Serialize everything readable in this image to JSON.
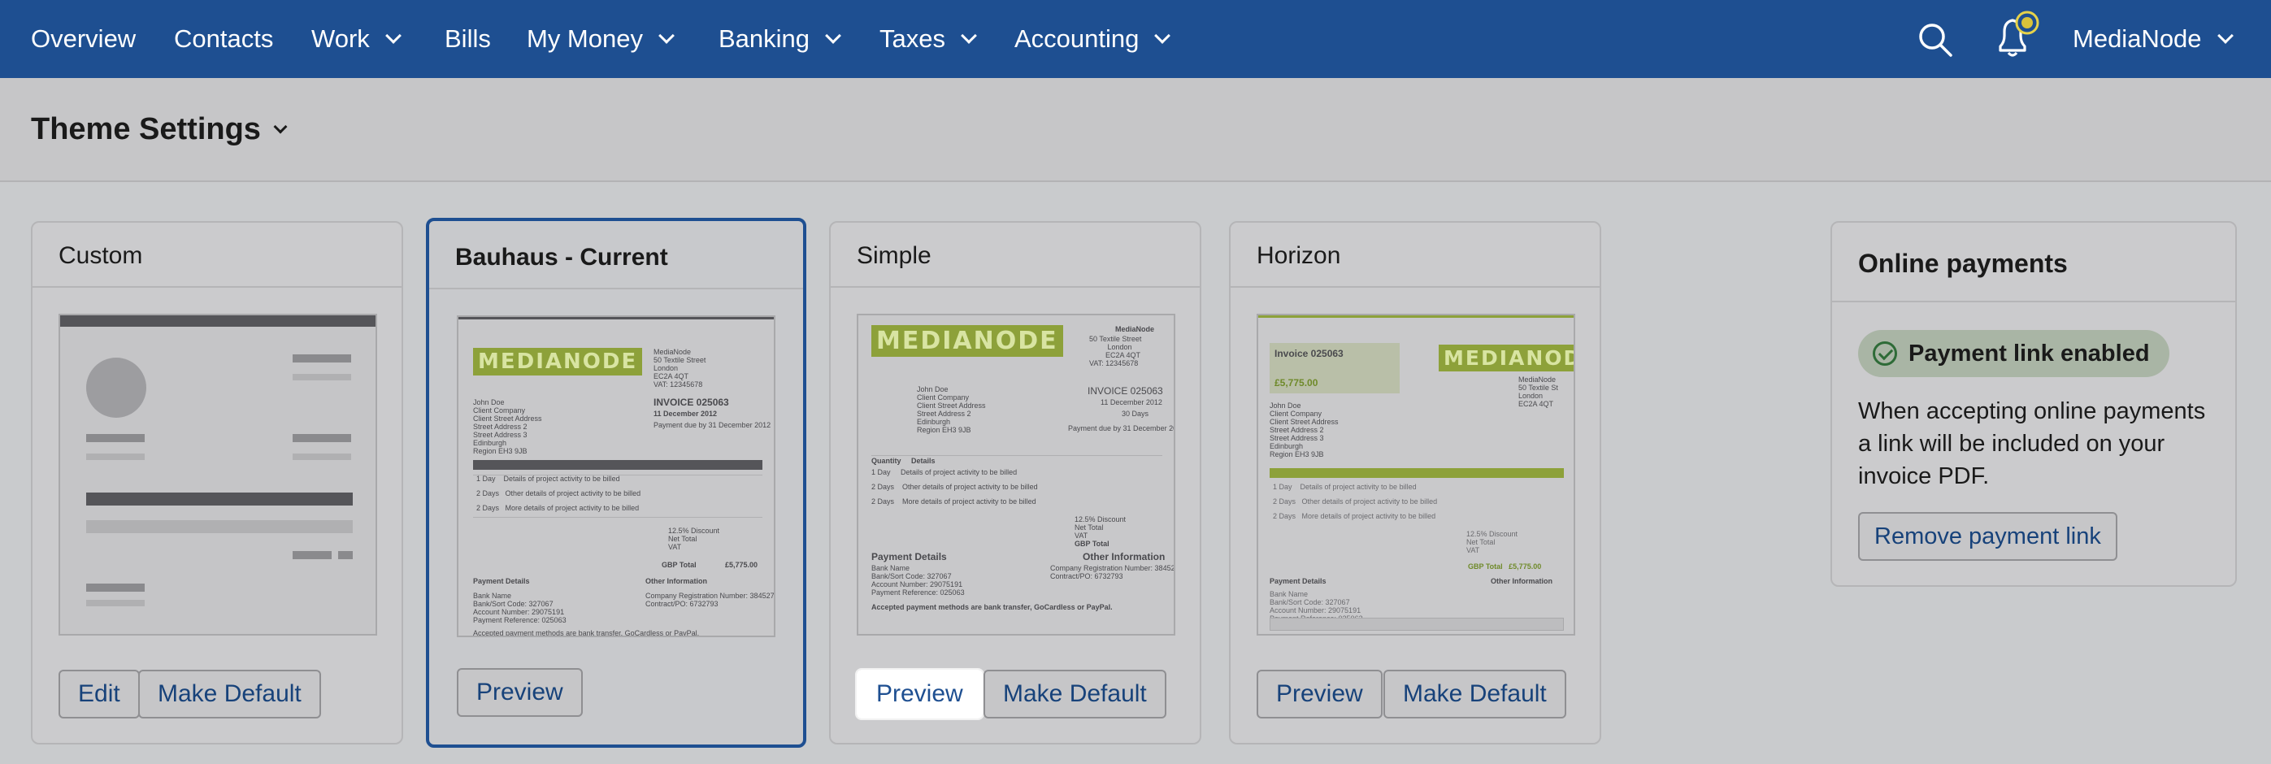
{
  "nav": {
    "items": [
      {
        "label": "Overview"
      },
      {
        "label": "Contacts"
      },
      {
        "label": "Work"
      },
      {
        "label": "Bills"
      },
      {
        "label": "My Money"
      },
      {
        "label": "Banking"
      },
      {
        "label": "Taxes"
      },
      {
        "label": "Accounting"
      }
    ],
    "account": "MediaNode",
    "icons": {
      "search": "search-icon",
      "notifications": "bell-icon"
    },
    "colors": {
      "bar": "#1e4f91",
      "notification_dot": "#d9c23a"
    }
  },
  "header": {
    "title": "Theme Settings"
  },
  "themes": [
    {
      "name": "Custom",
      "buttons": {
        "edit": "Edit",
        "make_default": "Make Default"
      }
    },
    {
      "name": "Bauhaus - Current",
      "current": true,
      "buttons": {
        "preview": "Preview"
      },
      "doc": {
        "logo": "MEDIANODE",
        "invoice": "INVOICE 025063",
        "date": "11 December 2012",
        "total_label": "GBP Total",
        "total": "£5,775.00",
        "payment_details": "Payment Details",
        "other_info": "Other Information"
      }
    },
    {
      "name": "Simple",
      "buttons": {
        "preview": "Preview",
        "make_default": "Make Default"
      },
      "doc": {
        "logo": "MEDIANODE",
        "company": "MediaNode",
        "invoice": "INVOICE 025063",
        "date": "11 December 2012",
        "payment_details": "Payment Details",
        "other_info": "Other Information"
      }
    },
    {
      "name": "Horizon",
      "buttons": {
        "preview": "Preview",
        "make_default": "Make Default"
      },
      "doc": {
        "logo": "MEDIANODE",
        "invoice": "Invoice 025063",
        "amount": "£5,775.00",
        "payment_details": "Payment Details",
        "other_info": "Other Information"
      }
    }
  ],
  "payments": {
    "title": "Online payments",
    "status": "Payment link enabled",
    "description": "When accepting online payments a link will be included on your invoice PDF.",
    "button": "Remove payment link",
    "status_color": "#2e6b37"
  },
  "accent_color": "#1e4f91"
}
